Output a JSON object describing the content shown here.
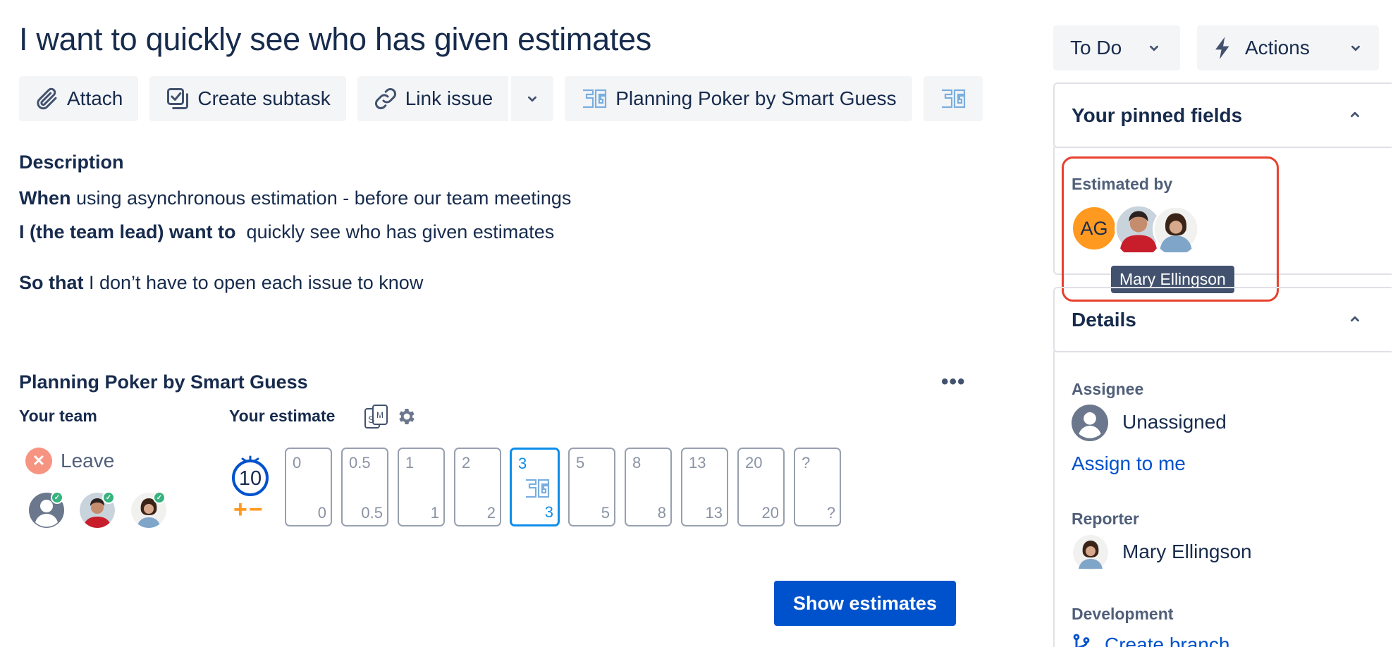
{
  "issue": {
    "title": "I want to quickly see who has given estimates"
  },
  "toolbar": {
    "attach_label": "Attach",
    "create_subtask_label": "Create subtask",
    "link_issue_label": "Link issue",
    "planning_poker_label": "Planning Poker by Smart Guess"
  },
  "description": {
    "heading": "Description",
    "line1_bold": "When",
    "line1_rest": " using asynchronous estimation - before our team meetings",
    "line2_bold": "I (the team lead) want to",
    "line2_rest": "  quickly see who has given estimates",
    "line3_bold": "So that",
    "line3_rest": " I don’t have to open each issue to know"
  },
  "planning_poker": {
    "title": "Planning Poker by Smart Guess",
    "more_label": "•••",
    "team_label": "Your team",
    "estimate_label": "Your estimate",
    "leave_label": "Leave",
    "timer_value": "10",
    "timer_adjust": "+−",
    "cards": [
      {
        "value": "0",
        "selected": false
      },
      {
        "value": "0.5",
        "selected": false
      },
      {
        "value": "1",
        "selected": false
      },
      {
        "value": "2",
        "selected": false
      },
      {
        "value": "3",
        "selected": true
      },
      {
        "value": "5",
        "selected": false
      },
      {
        "value": "8",
        "selected": false
      },
      {
        "value": "13",
        "selected": false
      },
      {
        "value": "20",
        "selected": false
      },
      {
        "value": "?",
        "selected": false
      }
    ],
    "show_estimates_label": "Show estimates"
  },
  "sidebar": {
    "status_label": "To Do",
    "actions_label": "Actions",
    "pinned_heading": "Your pinned fields",
    "estimated_by_label": "Estimated by",
    "ag_initials": "AG",
    "tooltip_text": "Mary Ellingson",
    "details_heading": "Details",
    "assignee_label": "Assignee",
    "assignee_value": "Unassigned",
    "assign_to_me": "Assign to me",
    "reporter_label": "Reporter",
    "reporter_value": "Mary Ellingson",
    "development_label": "Development",
    "create_branch": "Create branch"
  },
  "colors": {
    "primary": "#0052cc",
    "selected_card": "#0c8ee9",
    "highlight_border": "#e8402c",
    "ag_avatar": "#ff991f",
    "text": "#172b4d"
  }
}
